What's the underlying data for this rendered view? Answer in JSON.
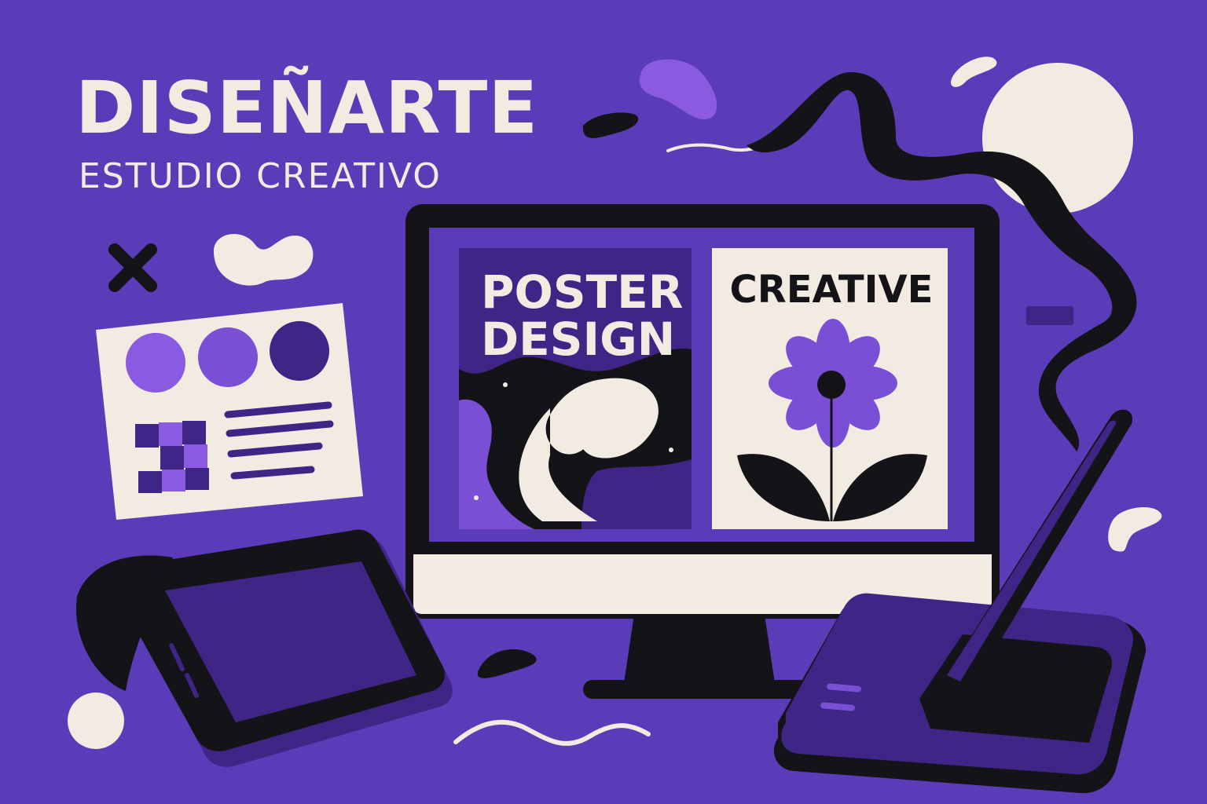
{
  "brand": {
    "title": "DISEÑARTE",
    "subtitle": "ESTUDIO CREATIVO"
  },
  "screen": {
    "left_poster": {
      "line1": "POSTER",
      "line2": "DESIGN"
    },
    "right_poster": {
      "title": "CREATIVE"
    }
  },
  "palette": {
    "background": "#5a3cb8",
    "cream": "#f1ebe2",
    "ink": "#141418",
    "light_purple": "#8a5ae0",
    "mid_purple": "#7a4fd6",
    "dark_purple": "#3f2586"
  },
  "swatch_card": {
    "circles": [
      "#8a5ae0",
      "#7a4fd6",
      "#3f2586"
    ]
  },
  "icons": [
    "close-icon",
    "flower-icon",
    "stylus-icon"
  ]
}
